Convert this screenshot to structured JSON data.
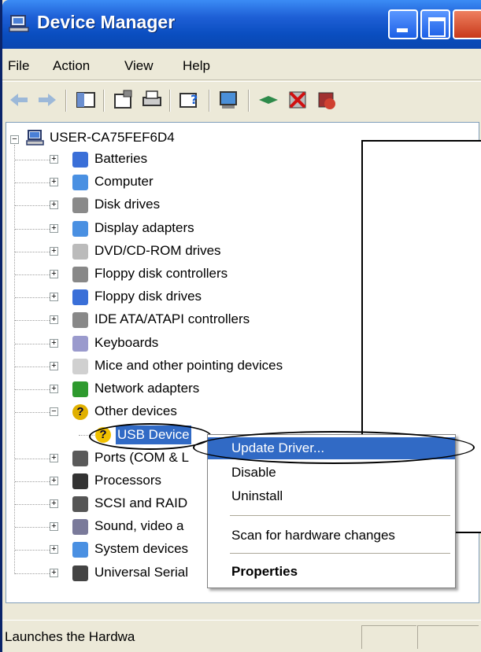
{
  "window": {
    "title": "Device Manager"
  },
  "menu": {
    "items": [
      "File",
      "Action",
      "View",
      "Help"
    ]
  },
  "toolbar": {
    "icons": [
      "back-arrow",
      "forward-arrow",
      "show-hide-console-tree",
      "properties",
      "print",
      "help",
      "scan-hardware",
      "update-driver",
      "uninstall",
      "disable"
    ]
  },
  "tree": {
    "root": "USER-CA75FEF6D4",
    "items": [
      {
        "label": "Batteries",
        "icon": "battery-icon",
        "color": "#3a6fd8"
      },
      {
        "label": "Computer",
        "icon": "computer-icon",
        "color": "#4a90e2"
      },
      {
        "label": "Disk drives",
        "icon": "disk-drive-icon",
        "color": "#8a8a8a"
      },
      {
        "label": "Display adapters",
        "icon": "monitor-icon",
        "color": "#4a90e2"
      },
      {
        "label": "DVD/CD-ROM drives",
        "icon": "dvd-icon",
        "color": "#bbbbbb"
      },
      {
        "label": "Floppy disk controllers",
        "icon": "controller-icon",
        "color": "#888888"
      },
      {
        "label": "Floppy disk drives",
        "icon": "floppy-icon",
        "color": "#3a6fd8"
      },
      {
        "label": "IDE ATA/ATAPI controllers",
        "icon": "controller-icon",
        "color": "#888888"
      },
      {
        "label": "Keyboards",
        "icon": "keyboard-icon",
        "color": "#9a9acd"
      },
      {
        "label": "Mice and other pointing devices",
        "icon": "mouse-icon",
        "color": "#d0d0d0"
      },
      {
        "label": "Network adapters",
        "icon": "network-icon",
        "color": "#2e9a2e"
      },
      {
        "label": "Other devices",
        "icon": "unknown-device-icon",
        "color": "#e0b000"
      },
      {
        "label": "USB Device",
        "icon": "warning-icon",
        "color": "#f0c000"
      },
      {
        "label": "Ports (COM & L",
        "icon": "port-icon",
        "color": "#5a5a5a"
      },
      {
        "label": "Processors",
        "icon": "processor-icon",
        "color": "#333333"
      },
      {
        "label": "SCSI and RAID",
        "icon": "scsi-icon",
        "color": "#555555"
      },
      {
        "label": "Sound, video a",
        "icon": "sound-icon",
        "color": "#7a7a9a"
      },
      {
        "label": "System devices",
        "icon": "system-icon",
        "color": "#4a90e2"
      },
      {
        "label": "Universal Serial",
        "icon": "usb-icon",
        "color": "#444444"
      }
    ]
  },
  "context_menu": {
    "items": [
      "Update Driver...",
      "Disable",
      "Uninstall",
      "Scan for hardware changes",
      "Properties"
    ]
  },
  "status": {
    "text": "Launches the Hardwa"
  }
}
